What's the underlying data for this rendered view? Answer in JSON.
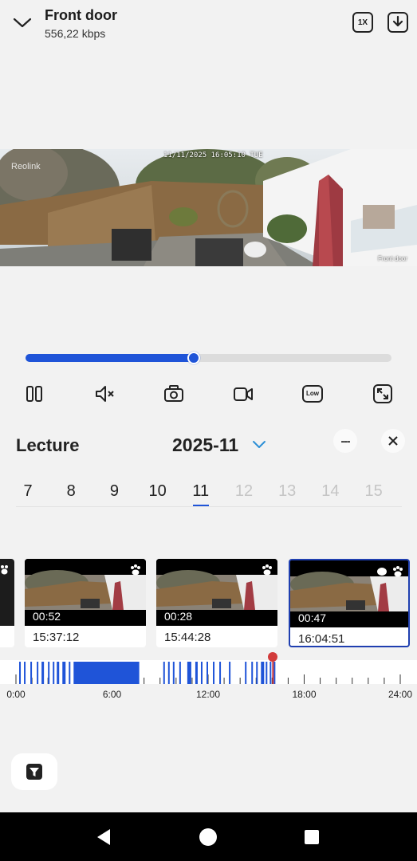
{
  "header": {
    "title": "Front door",
    "subtitle": "556,22 kbps",
    "speed_label": "1X"
  },
  "video": {
    "timestamp": "11/11/2025 16:05:10 TUE",
    "watermark_left": "Reolink",
    "watermark_right": "Front door"
  },
  "progress": {
    "fraction": 0.459
  },
  "controls": {
    "quality_label": "Low"
  },
  "playback": {
    "heading": "Lecture",
    "month": "2025-11",
    "more_label": "---"
  },
  "days": [
    {
      "label": "7",
      "state": "normal"
    },
    {
      "label": "8",
      "state": "normal"
    },
    {
      "label": "9",
      "state": "normal"
    },
    {
      "label": "10",
      "state": "normal"
    },
    {
      "label": "11",
      "state": "active"
    },
    {
      "label": "12",
      "state": "disabled"
    },
    {
      "label": "13",
      "state": "disabled"
    },
    {
      "label": "14",
      "state": "disabled"
    },
    {
      "label": "15",
      "state": "disabled"
    }
  ],
  "clips": [
    {
      "duration": "00:52",
      "time": "15:37:12",
      "selected": false
    },
    {
      "duration": "00:28",
      "time": "15:44:28",
      "selected": false
    },
    {
      "duration": "00:47",
      "time": "16:04:51",
      "selected": true
    }
  ],
  "timeline": {
    "labels": [
      "0:00",
      "6:00",
      "12:00",
      "18:00",
      "24:00"
    ],
    "accent_color": "#1f54d8",
    "marker_color": "#d23b3b"
  }
}
